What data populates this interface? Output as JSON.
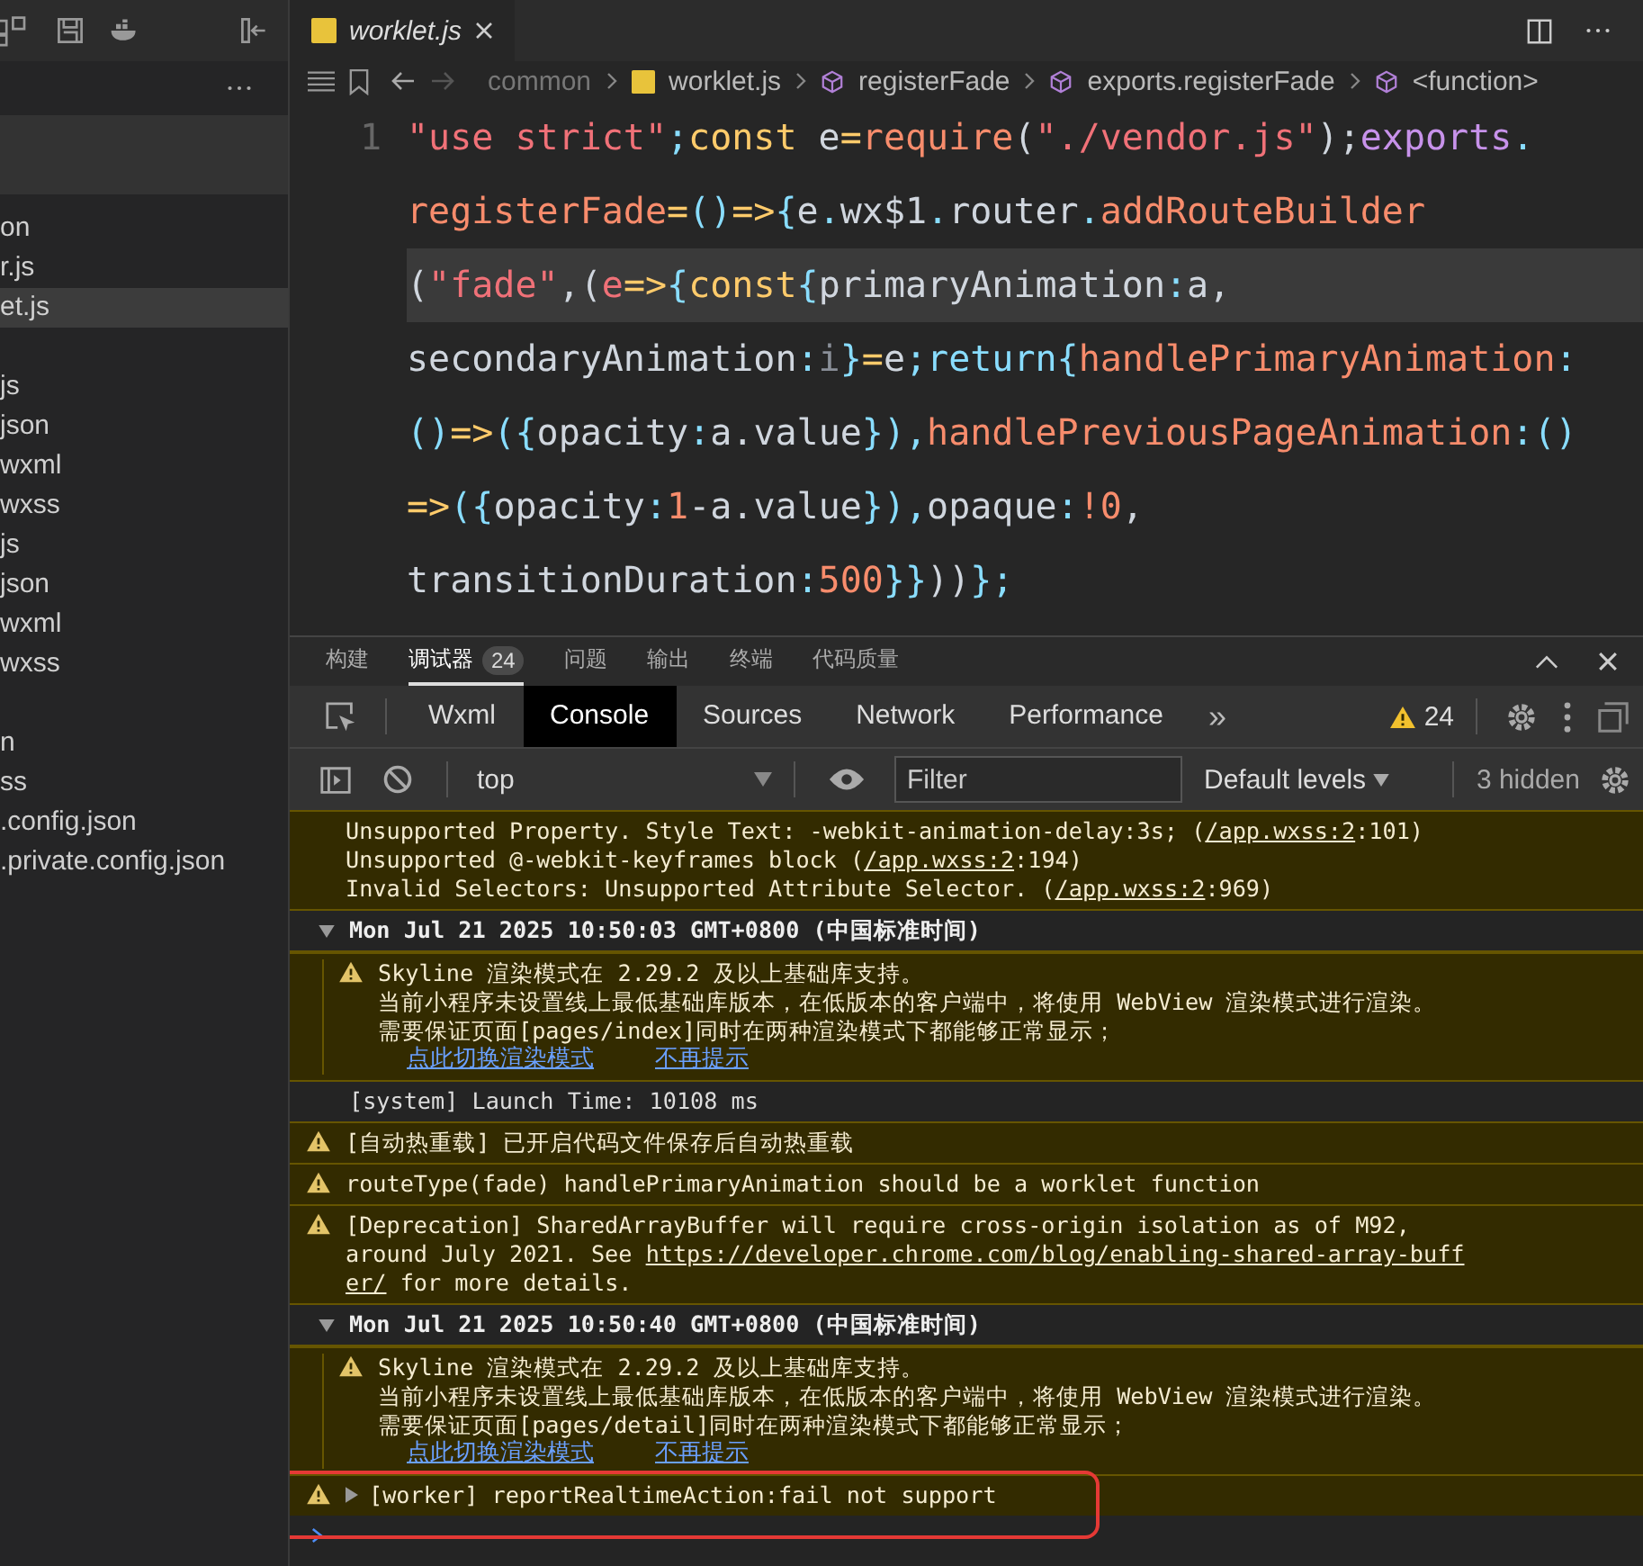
{
  "sidebar": {
    "groups": [
      [
        {
          "label": "on",
          "selected": false
        },
        {
          "label": "r.js",
          "selected": false
        },
        {
          "label": "et.js",
          "selected": true
        }
      ],
      [
        {
          "label": "js",
          "selected": false
        },
        {
          "label": "json",
          "selected": false
        },
        {
          "label": "wxml",
          "selected": false
        },
        {
          "label": "wxss",
          "selected": false
        },
        {
          "label": "js",
          "selected": false
        },
        {
          "label": "json",
          "selected": false
        },
        {
          "label": "wxml",
          "selected": false
        },
        {
          "label": "wxss",
          "selected": false
        }
      ],
      [
        {
          "label": "n",
          "selected": false
        },
        {
          "label": "ss",
          "selected": false
        },
        {
          "label": ".config.json",
          "selected": false
        },
        {
          "label": ".private.config.json",
          "selected": false
        }
      ]
    ]
  },
  "editor": {
    "tabs": [
      {
        "label": "worklet.js",
        "selected": true
      }
    ],
    "breadcrumb": [
      {
        "label": "common",
        "kind": "folder"
      },
      {
        "label": "worklet.js",
        "kind": "file"
      },
      {
        "label": "registerFade",
        "kind": "symbol"
      },
      {
        "label": "exports.registerFade",
        "kind": "symbol"
      },
      {
        "label": "<function>",
        "kind": "symbol"
      }
    ],
    "line_number": "1",
    "code_lines": [
      {
        "current": false,
        "tokens": [
          {
            "t": "\"use strict\"",
            "kind": "str"
          },
          {
            "t": ";",
            "kind": "op"
          },
          {
            "t": "const",
            "kind": "kw"
          },
          {
            "t": " e",
            "kind": "plain"
          },
          {
            "t": "=",
            "kind": "kw"
          },
          {
            "t": "require",
            "kind": "fn"
          },
          {
            "t": "(",
            "kind": "plain"
          },
          {
            "t": "\"./vendor.js\"",
            "kind": "str"
          },
          {
            "t": ");",
            "kind": "plain"
          },
          {
            "t": "exports",
            "kind": "prop"
          },
          {
            "t": ".",
            "kind": "op"
          }
        ]
      },
      {
        "current": false,
        "tokens": [
          {
            "t": "registerFade",
            "kind": "fn"
          },
          {
            "t": "=",
            "kind": "kw"
          },
          {
            "t": "()",
            "kind": "op"
          },
          {
            "t": "=>",
            "kind": "kw"
          },
          {
            "t": "{",
            "kind": "op"
          },
          {
            "t": "e",
            "kind": "plain"
          },
          {
            "t": ".",
            "kind": "op"
          },
          {
            "t": "wx$1",
            "kind": "plain"
          },
          {
            "t": ".",
            "kind": "op"
          },
          {
            "t": "router",
            "kind": "plain"
          },
          {
            "t": ".",
            "kind": "op"
          },
          {
            "t": "addRouteBuilder",
            "kind": "fn"
          }
        ]
      },
      {
        "current": true,
        "tokens": [
          {
            "t": "(",
            "kind": "plain"
          },
          {
            "t": "\"fade\"",
            "kind": "str"
          },
          {
            "t": ",(",
            "kind": "plain"
          },
          {
            "t": "e",
            "kind": "str"
          },
          {
            "t": "=>",
            "kind": "kw"
          },
          {
            "t": "{",
            "kind": "op"
          },
          {
            "t": "const",
            "kind": "kw"
          },
          {
            "t": "{",
            "kind": "op"
          },
          {
            "t": "primaryAnimation",
            "kind": "plain"
          },
          {
            "t": ":",
            "kind": "op"
          },
          {
            "t": "a,",
            "kind": "plain"
          }
        ]
      },
      {
        "current": false,
        "tokens": [
          {
            "t": "secondaryAnimation",
            "kind": "plain"
          },
          {
            "t": ":",
            "kind": "op"
          },
          {
            "t": "i",
            "kind": "dim"
          },
          {
            "t": "}",
            "kind": "op"
          },
          {
            "t": "=",
            "kind": "kw"
          },
          {
            "t": "e",
            "kind": "plain"
          },
          {
            "t": ";",
            "kind": "op"
          },
          {
            "t": "return",
            "kind": "op"
          },
          {
            "t": "{",
            "kind": "op"
          },
          {
            "t": "handlePrimaryAnimation",
            "kind": "fn"
          },
          {
            "t": ":",
            "kind": "op"
          }
        ]
      },
      {
        "current": false,
        "tokens": [
          {
            "t": "()",
            "kind": "op"
          },
          {
            "t": "=>",
            "kind": "kw"
          },
          {
            "t": "({",
            "kind": "op"
          },
          {
            "t": "opacity",
            "kind": "plain"
          },
          {
            "t": ":",
            "kind": "op"
          },
          {
            "t": "a.value",
            "kind": "plain"
          },
          {
            "t": "}),",
            "kind": "op"
          },
          {
            "t": "handlePreviousPageAnimation",
            "kind": "fn"
          },
          {
            "t": ":()",
            "kind": "op"
          }
        ]
      },
      {
        "current": false,
        "tokens": [
          {
            "t": "=>",
            "kind": "kw"
          },
          {
            "t": "({",
            "kind": "op"
          },
          {
            "t": "opacity",
            "kind": "plain"
          },
          {
            "t": ":",
            "kind": "op"
          },
          {
            "t": "1",
            "kind": "num"
          },
          {
            "t": "-a.value",
            "kind": "plain"
          },
          {
            "t": "}),",
            "kind": "op"
          },
          {
            "t": "opaque",
            "kind": "plain"
          },
          {
            "t": ":",
            "kind": "op"
          },
          {
            "t": "!0",
            "kind": "num"
          },
          {
            "t": ",",
            "kind": "plain"
          }
        ]
      },
      {
        "current": false,
        "tokens": [
          {
            "t": "transitionDuration",
            "kind": "plain"
          },
          {
            "t": ":",
            "kind": "op"
          },
          {
            "t": "500",
            "kind": "num"
          },
          {
            "t": "}}",
            "kind": "op"
          },
          {
            "t": "))",
            "kind": "plain"
          },
          {
            "t": "};",
            "kind": "op"
          }
        ]
      }
    ]
  },
  "panel": {
    "tabs": [
      {
        "label": "构建",
        "selected": false
      },
      {
        "label": "调试器",
        "selected": true,
        "badge": "24"
      },
      {
        "label": "问题",
        "selected": false
      },
      {
        "label": "输出",
        "selected": false
      },
      {
        "label": "终端",
        "selected": false
      },
      {
        "label": "代码质量",
        "selected": false
      }
    ],
    "devtools_tabs": [
      {
        "label": "Wxml",
        "selected": false
      },
      {
        "label": "Console",
        "selected": true
      },
      {
        "label": "Sources",
        "selected": false
      },
      {
        "label": "Network",
        "selected": false
      },
      {
        "label": "Performance",
        "selected": false
      }
    ],
    "more_tabs": "»",
    "warning_count": "24",
    "context": "top",
    "filter": {
      "placeholder": "Filter"
    },
    "levels": "Default levels",
    "hidden": "3 hidden",
    "messages": [
      {
        "kind": "warning",
        "icon": false,
        "nested": false,
        "lines": [
          [
            {
              "text": "Unsupported Property. Style Text: -webkit-animation-delay:3s; ("
            },
            {
              "text": "/app.wxss:2",
              "link": true
            },
            {
              "text": ":101)"
            }
          ],
          [
            {
              "text": "Unsupported @-webkit-keyframes block ("
            },
            {
              "text": "/app.wxss:2",
              "link": true
            },
            {
              "text": ":194)"
            }
          ],
          [
            {
              "text": "Invalid Selectors: Unsupported Attribute Selector. ("
            },
            {
              "text": "/app.wxss:2",
              "link": true
            },
            {
              "text": ":969)"
            }
          ]
        ]
      },
      {
        "kind": "group",
        "text": "Mon Jul 21 2025 10:50:03 GMT+0800 (中国标准时间)",
        "expanded": true
      },
      {
        "kind": "warning",
        "icon": true,
        "nested": true,
        "lines": [
          [
            {
              "text": "Skyline 渲染模式在 2.29.2 及以上基础库支持。"
            }
          ],
          [
            {
              "text": "当前小程序未设置线上最低基础库版本，在低版本的客户端中，将使用 WebView 渲染模式进行渲染。"
            }
          ],
          [
            {
              "text": "需要保证页面[pages/index]同时在两种渲染模式下都能够正常显示；"
            }
          ]
        ],
        "actions": [
          "点此切换渲染模式",
          "不再提示"
        ]
      },
      {
        "kind": "info",
        "nested": true,
        "lines": [
          [
            {
              "text": "[system] Launch Time: 10108 ms"
            }
          ]
        ]
      },
      {
        "kind": "warning",
        "icon": true,
        "nested": false,
        "lines": [
          [
            {
              "text": "[自动热重载] 已开启代码文件保存后自动热重载"
            }
          ]
        ]
      },
      {
        "kind": "warning",
        "icon": true,
        "nested": false,
        "lines": [
          [
            {
              "text": "routeType(fade) handlePrimaryAnimation should be a worklet function"
            }
          ]
        ]
      },
      {
        "kind": "warning",
        "icon": true,
        "nested": false,
        "lines": [
          [
            {
              "text": "[Deprecation] SharedArrayBuffer will require cross-origin isolation as of M92,"
            }
          ],
          [
            {
              "text": "around July 2021. See "
            },
            {
              "text": "https://developer.chrome.com/blog/enabling-shared-array-buff",
              "link": true
            }
          ],
          [
            {
              "text": "er/",
              "link": true
            },
            {
              "text": " for more details."
            }
          ]
        ]
      },
      {
        "kind": "group",
        "text": "Mon Jul 21 2025 10:50:40 GMT+0800 (中国标准时间)",
        "expanded": true
      },
      {
        "kind": "warning",
        "icon": true,
        "nested": true,
        "lines": [
          [
            {
              "text": "Skyline 渲染模式在 2.29.2 及以上基础库支持。"
            }
          ],
          [
            {
              "text": "当前小程序未设置线上最低基础库版本，在低版本的客户端中，将使用 WebView 渲染模式进行渲染。"
            }
          ],
          [
            {
              "text": "需要保证页面[pages/detail]同时在两种渲染模式下都能够正常显示；"
            }
          ]
        ],
        "actions": [
          "点此切换渲染模式",
          "不再提示"
        ]
      },
      {
        "kind": "warning",
        "icon": true,
        "nested": false,
        "expanded": false,
        "highlighted": true,
        "lines": [
          [
            {
              "text": "[worker] reportRealtimeAction:fail not support"
            }
          ]
        ]
      }
    ]
  }
}
